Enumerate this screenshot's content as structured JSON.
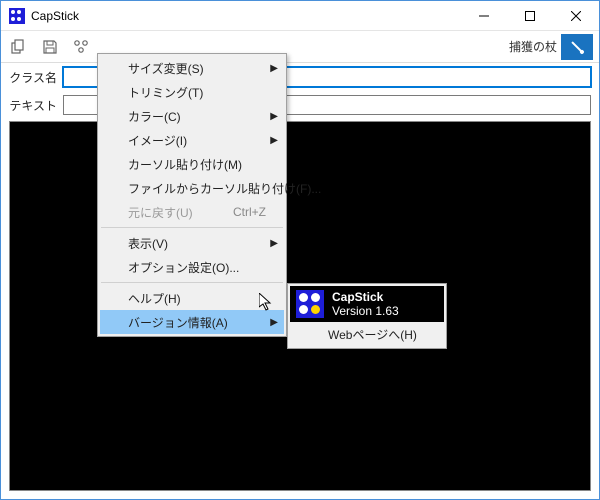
{
  "window": {
    "title": "CapStick"
  },
  "toolbar": {
    "capture_label": "捕獲の杖"
  },
  "form": {
    "class_label": "クラス名",
    "class_value": "",
    "text_label": "テキスト",
    "text_value": ""
  },
  "menu": {
    "resize": "サイズ変更(S)",
    "trimming": "トリミング(T)",
    "color": "カラー(C)",
    "image": "イメージ(I)",
    "cursor_paste": "カーソル貼り付け(M)",
    "cursor_paste_file": "ファイルからカーソル貼り付け(F)...",
    "undo": "元に戻す(U)",
    "undo_shortcut": "Ctrl+Z",
    "view": "表示(V)",
    "options": "オプション設定(O)...",
    "help": "ヘルプ(H)",
    "version": "バージョン情報(A)"
  },
  "about": {
    "name": "CapStick",
    "version": "Version 1.63",
    "webpage": "Webページへ(H)"
  }
}
